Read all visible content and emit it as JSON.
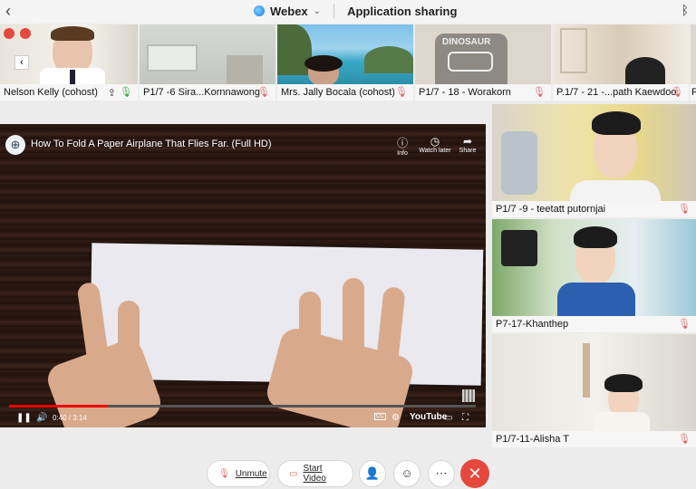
{
  "header": {
    "app_name": "Webex",
    "chevron": "⌄",
    "title": "Application sharing"
  },
  "thumbnails": [
    {
      "name": "Nelson Kelly (cohost)"
    },
    {
      "name": "P1/7 -6 Sira...Kornnawong"
    },
    {
      "name": "Mrs. Jally Bocala (cohost)"
    },
    {
      "name": "P1/7 - 18 - Worakorn"
    },
    {
      "name": "P.1/7 - 21 -...path Kaewdoo"
    },
    {
      "name": "F"
    }
  ],
  "video": {
    "title": "How To Fold A Paper Airplane That Flies Far. (Full HD)",
    "tools": [
      {
        "label": "Info",
        "icon": "info-icon"
      },
      {
        "label": "Watch later",
        "icon": "clock-icon"
      },
      {
        "label": "Share",
        "icon": "share-icon"
      }
    ],
    "time": "0:40 / 3:14",
    "progress": 0.21,
    "shirt_text": "DINOSAUR",
    "brand": "YouTube",
    "cc": "CC"
  },
  "side_panels": [
    {
      "name": "P1/7 -9 - teetatt putornjai"
    },
    {
      "name": "P7-17-Khanthep"
    },
    {
      "name": "P1/7-11-Alisha T"
    }
  ],
  "bottom": {
    "unmute": "Unmute",
    "start_video": "Start Video",
    "participants_icon": "person-icon",
    "reactions_icon": "smiley-icon",
    "more_icon": "more-icon",
    "end_icon": "close-icon"
  },
  "colors": {
    "end_call": "#e5483d",
    "muted_mic": "#e06666",
    "active_mic": "#3aa94a",
    "progress": "#ee0000"
  }
}
